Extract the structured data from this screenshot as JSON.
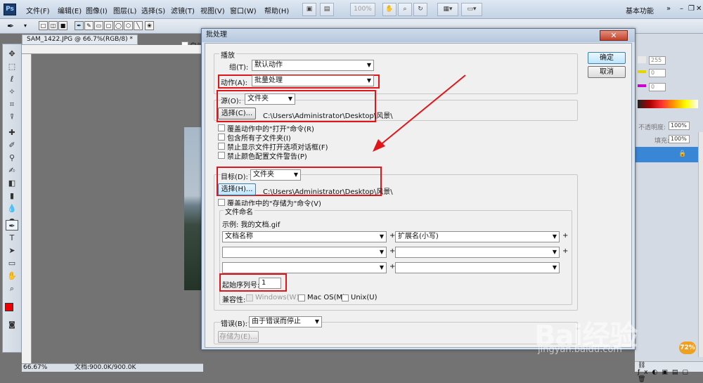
{
  "menubar": {
    "logo": "Ps",
    "items": [
      "文件(F)",
      "编辑(E)",
      "图像(I)",
      "图层(L)",
      "选择(S)",
      "滤镜(T)",
      "视图(V)",
      "窗口(W)",
      "帮助(H)"
    ],
    "zoom": "100%",
    "workspace": "基本功能"
  },
  "options": {
    "auto_add": "自动添加/删除"
  },
  "document": {
    "tab": "SAM_1422.JPG @ 66.7%(RGB/8) *",
    "zoom": "66.67%",
    "docsize": "文档:900.0K/900.0K"
  },
  "right_panel": {
    "v1": "255",
    "v2": "0",
    "v3": "0",
    "opacity_label": "不透明度:",
    "opacity": "100%",
    "fill_label": "填充:",
    "fill": "100%"
  },
  "dialog": {
    "title": "批处理",
    "ok": "确定",
    "cancel": "取消",
    "play": {
      "legend": "播放",
      "set_label": "组(T):",
      "set_value": "默认动作",
      "action_label": "动作(A):",
      "action_value": "批量处理"
    },
    "source": {
      "label": "源(O):",
      "value": "文件夹",
      "choose": "选择(C)...",
      "path": "C:\\Users\\Administrator\\Desktop\\风景\\",
      "checks": [
        "覆盖动作中的\"打开\"命令(R)",
        "包含所有子文件夹(I)",
        "禁止显示文件打开选项对话框(F)",
        "禁止颜色配置文件警告(P)"
      ]
    },
    "dest": {
      "label": "目标(D):",
      "value": "文件夹",
      "choose": "选择(H)...",
      "path": "C:\\Users\\Administrator\\Desktop\\风景\\",
      "override": "覆盖动作中的\"存储为\"命令(V)",
      "naming": {
        "legend": "文件命名",
        "example": "示例: 我的文档.gif",
        "row1_a": "文档名称",
        "row1_b": "扩展名(小写)",
        "plus": "+",
        "serial_label": "起始序列号:",
        "serial": "1"
      },
      "compat_label": "兼容性:",
      "compat": [
        "Windows(W)",
        "Mac OS(M)",
        "Unix(U)"
      ]
    },
    "errors": {
      "label": "错误(B):",
      "value": "由于错误而停止",
      "save_as": "存储为(E)..."
    }
  },
  "watermark": {
    "brand": "Bai经验",
    "url": "jingyan.baidu.com",
    "badge": "72%"
  }
}
